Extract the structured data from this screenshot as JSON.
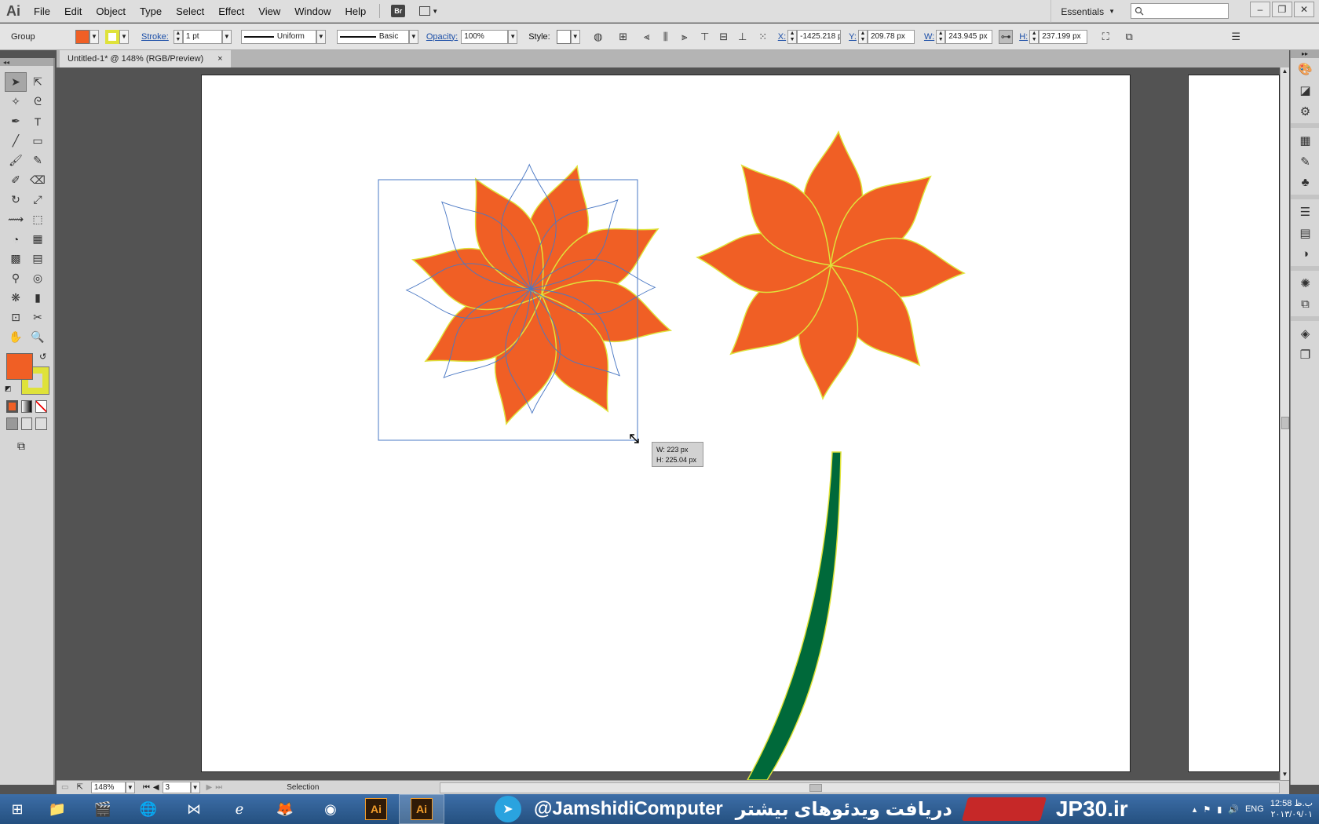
{
  "app": {
    "logo": "Ai",
    "menu": [
      "File",
      "Edit",
      "Object",
      "Type",
      "Select",
      "Effect",
      "View",
      "Window",
      "Help"
    ],
    "bridge_label": "Br",
    "workspace": "Essentials"
  },
  "control": {
    "selection_type": "Group",
    "fill_color": "#f05f25",
    "stroke_color": "#dfe23a",
    "stroke_label": "Stroke:",
    "stroke_weight": "1 pt",
    "profile": "Uniform",
    "brush": "Basic",
    "opacity_label": "Opacity:",
    "opacity": "100%",
    "style_label": "Style:",
    "x_label": "X:",
    "x_value": "-1425.218 p",
    "y_label": "Y:",
    "y_value": "209.78 px",
    "w_label": "W:",
    "w_value": "243.945 px",
    "h_label": "H:",
    "h_value": "237.199 px"
  },
  "document": {
    "tab_title": "Untitled-1* @ 148% (RGB/Preview)",
    "close": "×"
  },
  "tooltip": {
    "w": "W: 223 px",
    "h": "H: 225.04 px"
  },
  "status": {
    "zoom": "148%",
    "artboard": "3",
    "tool": "Selection"
  },
  "colors": {
    "petal": "#f05f25",
    "petal_stroke": "#dfe23a",
    "stem": "#00693a",
    "selection": "#4a78c4"
  },
  "taskbar": {
    "banner_handle": "@JamshidiComputer",
    "banner_persian": "دریافت ویدئوهای بیشتر",
    "banner_site": "JP30.ir",
    "lang": "ENG",
    "time": "12:58 ب.ظ",
    "date": "۲۰۱۳/۰۹/۰۱"
  }
}
